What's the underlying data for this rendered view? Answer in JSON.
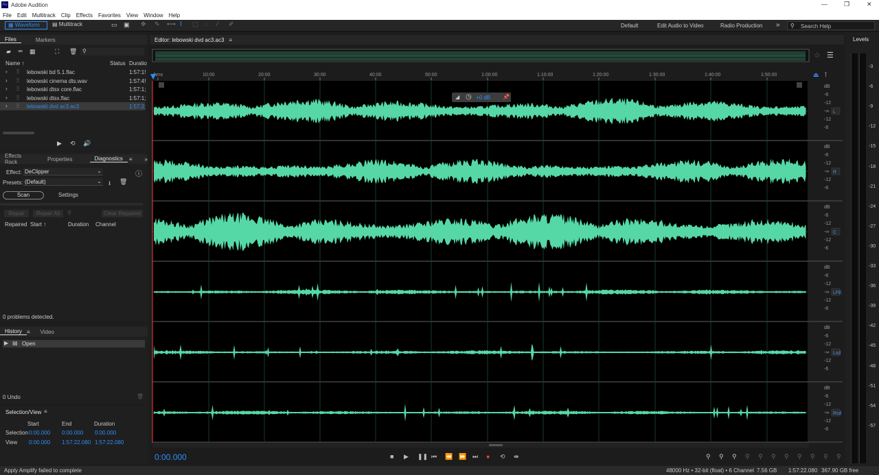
{
  "app": {
    "title": "Adobe Audition",
    "logo": "Au"
  },
  "menu": [
    "File",
    "Edit",
    "Multitrack",
    "Clip",
    "Effects",
    "Favorites",
    "View",
    "Window",
    "Help"
  ],
  "toolbar": {
    "waveform": "Waveform",
    "multitrack": "Multitrack",
    "workspaces": [
      "Default",
      "Edit Audio to Video",
      "Radio Production"
    ],
    "more": "»",
    "search_placeholder": "Search Help"
  },
  "files": {
    "tabs": [
      "Files",
      "Markers"
    ],
    "columns": [
      "Name ↑",
      "Status",
      "Duratio"
    ],
    "items": [
      {
        "name": "lebowski bd 5.1.flac",
        "duration": "1:57:1!"
      },
      {
        "name": "lebowski cinema dts.wav",
        "duration": "1:57:4!"
      },
      {
        "name": "lebowski dtsx core.flac",
        "duration": "1:57:1;"
      },
      {
        "name": "lebowski dtsx.flac",
        "duration": "1:57:1;"
      },
      {
        "name": "lebowski dvd ac3.ac3",
        "duration": "1:57:2;"
      }
    ]
  },
  "diag": {
    "tabs": [
      "Effects Rack",
      "Properties",
      "Diagnostics"
    ],
    "effect_label": "Effect:",
    "effect": "DeClipper",
    "presets_label": "Presets:",
    "preset": "(Default)",
    "scan": "Scan",
    "settings": "Settings",
    "repair": "Repair",
    "repair_all": "Repair All",
    "clear": "Clear Repaired",
    "columns": [
      "Repaired",
      "Start ↑",
      "Duration",
      "Channel"
    ],
    "status": "0 problems detected."
  },
  "history": {
    "tabs": [
      "History",
      "Video"
    ],
    "item": "Open",
    "undo": "0 Undo"
  },
  "selview": {
    "title": "Selection/View",
    "cols": [
      "Start",
      "End",
      "Duration"
    ],
    "rows": [
      {
        "label": "Selection",
        "start": "0:00.000",
        "end": "0:00.000",
        "duration": "0:00.000"
      },
      {
        "label": "View",
        "start": "0:00.000",
        "end": "1:57:22.080",
        "duration": "1:57:22.080"
      }
    ]
  },
  "editor": {
    "title": "Editor: lebowski dvd ac3.ac3",
    "time": "0:00.000",
    "hud": "+0 dB",
    "ruler": [
      "hms",
      "10:00",
      "20:00",
      "30:00",
      "40:00",
      "50:00",
      "1:00:00",
      "1:10:00",
      "1:20:00",
      "1:30:00",
      "1:40:00",
      "1:50:00"
    ],
    "channels": [
      "L",
      "R",
      "C",
      "LFE",
      "Lsd",
      "Rsd"
    ],
    "db": [
      "dB",
      "-6",
      "-12",
      "-∞",
      "-12",
      "-6"
    ]
  },
  "levels": {
    "title": "Levels",
    "scale": [
      "-3",
      "-6",
      "-9",
      "-12",
      "-15",
      "-18",
      "-21",
      "-24",
      "-27",
      "-30",
      "-33",
      "-36",
      "-39",
      "-42",
      "-45",
      "-48",
      "-51",
      "-54",
      "-57"
    ]
  },
  "status": {
    "message": "Apply Amplify failed to complete",
    "sample": "48000 Hz • 32-bit (float) • 6 Channel",
    "size": "7.56 GB",
    "duration": "1:57:22.080",
    "free": "367.90 GB free"
  }
}
